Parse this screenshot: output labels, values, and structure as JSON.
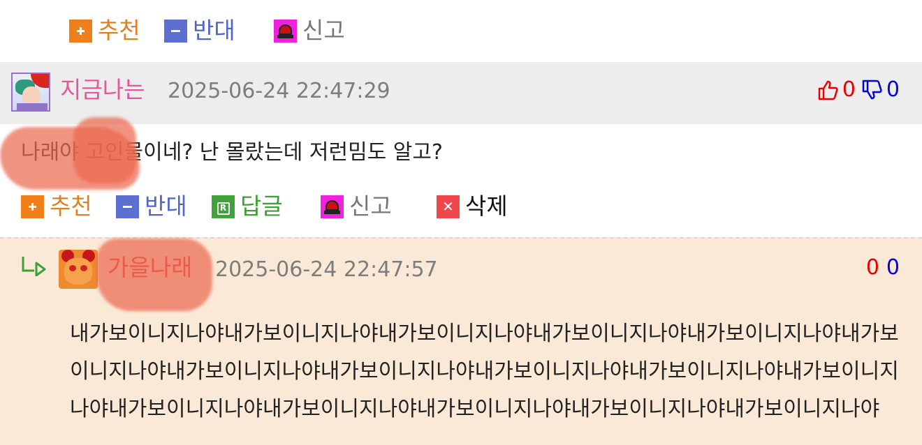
{
  "top_actions": {
    "recommend": "추천",
    "oppose": "반대",
    "report": "신고"
  },
  "comment": {
    "nickname": "지금나는",
    "timestamp": "2025-06-24 22:47:29",
    "likes": "0",
    "dislikes": "0",
    "text": "나래야 고인물이네? 난 몰랐는데 저런밈도 알고?",
    "actions": {
      "recommend": "추천",
      "oppose": "반대",
      "reply": "답글",
      "report": "신고",
      "delete": "삭제"
    }
  },
  "reply": {
    "nickname": "가을나래",
    "timestamp": "2025-06-24 22:47:57",
    "likes": "0",
    "dislikes": "0",
    "text": "내가보이니지나야내가보이니지나야내가보이니지나야내가보이니지나야내가보이니지나야내가보이니지나야내가보이니지나야내가보이니지나야내가보이니지나야내가보이니지나야내가보이니지나야내가보이니지나야내가보이니지나야내가보이니지나야내가보이니지나야내가보이니지나야"
  },
  "icons": {
    "recommend": "plus-icon",
    "oppose": "minus-icon",
    "reply": "reply-icon",
    "report": "siren-icon",
    "delete": "x-icon",
    "like": "thumbs-up-icon",
    "dislike": "thumbs-down-icon",
    "reply_indent": "reply-arrow-icon"
  },
  "colors": {
    "recommend": "#e2801f",
    "oppose": "#5066c6",
    "reply": "#3e9f36",
    "nickname_comment": "#e8559b",
    "nickname_reply": "#e8363a",
    "reply_background": "#fbe9d7",
    "header_background": "#ededed"
  }
}
